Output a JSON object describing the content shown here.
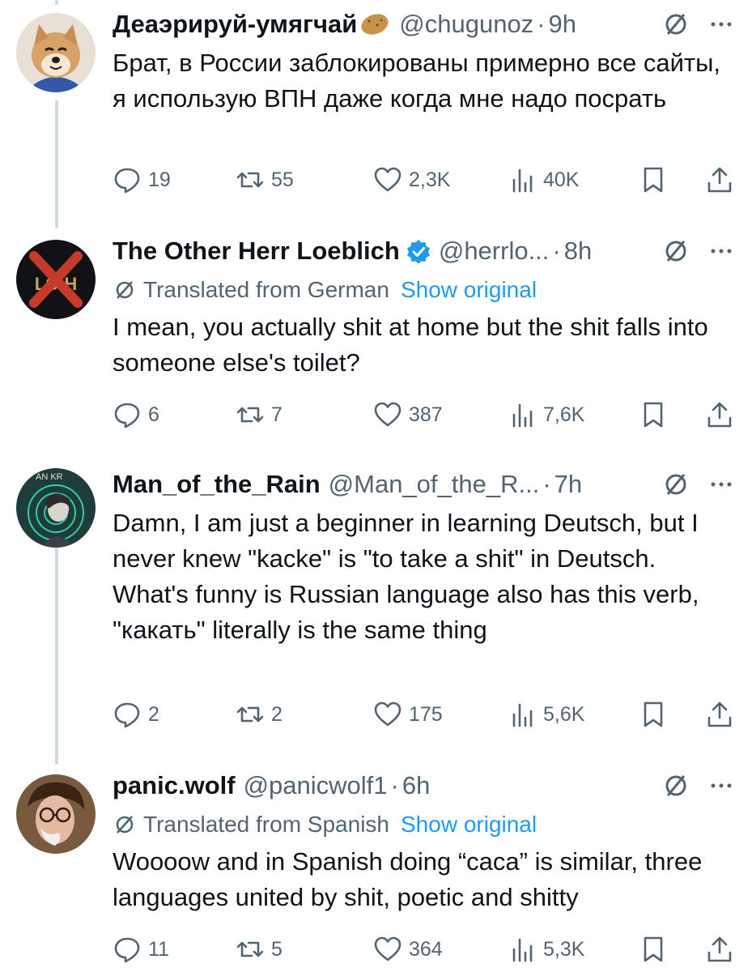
{
  "colors": {
    "text": "#0f1419",
    "secondary": "#536471",
    "link": "#1d9bf0",
    "verified": "#1d9bf0",
    "thread_line": "#cfd9de"
  },
  "tweets": [
    {
      "name": "Деаэрируй-умягчай",
      "name_emoji": "potato-icon",
      "handle": "@chugunoz",
      "time": "9h",
      "translated": "",
      "show_original": "",
      "text": "Брат, в России заблокированы примерно все сайты, я использую ВПН даже когда мне надо посрать",
      "stats": {
        "replies": "19",
        "retweets": "55",
        "likes": "2,3K",
        "views": "40K"
      }
    },
    {
      "name": "The Other Herr Loeblich",
      "verified": true,
      "handle": "@herrlo...",
      "time": "8h",
      "translated": "Translated from German",
      "show_original": "Show original",
      "text": "I mean, you actually shit at home but the shit falls into someone else's toilet?",
      "stats": {
        "replies": "6",
        "retweets": "7",
        "likes": "387",
        "views": "7,6K"
      }
    },
    {
      "name": "Man_of_the_Rain",
      "handle": "@Man_of_the_R...",
      "time": "7h",
      "translated": "",
      "show_original": "",
      "text": "Damn, I am just a beginner in learning Deutsch, but I never knew \"kacke\" is \"to take a shit\" in Deutsch. What's funny is Russian language also has this verb, \"какать\" literally is the same thing",
      "stats": {
        "replies": "2",
        "retweets": "2",
        "likes": "175",
        "views": "5,6K"
      }
    },
    {
      "name": "panic.wolf",
      "handle": "@panicwolf1",
      "time": "6h",
      "translated": "Translated from Spanish",
      "show_original": "Show original",
      "text": "Woooow and in Spanish doing “caca” is similar, three languages united by shit, poetic and shitty",
      "stats": {
        "replies": "11",
        "retweets": "5",
        "likes": "364",
        "views": "5,3K"
      }
    }
  ]
}
